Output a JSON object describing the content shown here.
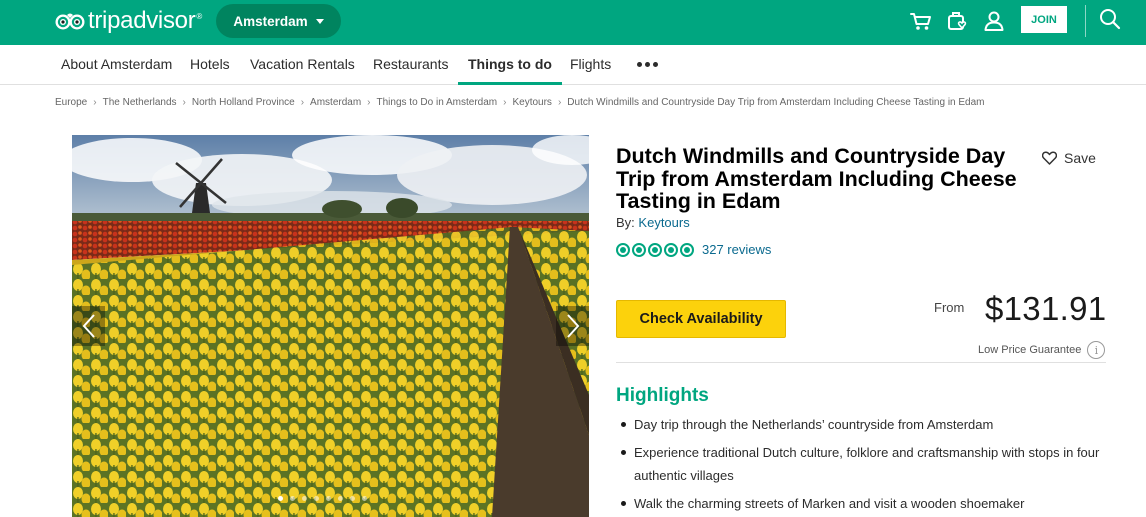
{
  "header": {
    "logo_text": "tripadvisor",
    "logo_reg": "®",
    "city": "Amsterdam",
    "join_label": "JOIN",
    "icons": [
      "cart-icon",
      "luggage-heart-icon",
      "user-icon",
      "search-icon"
    ],
    "brand_color": "#00a680"
  },
  "nav": {
    "items": [
      {
        "label": "About Amsterdam"
      },
      {
        "label": "Hotels"
      },
      {
        "label": "Vacation Rentals"
      },
      {
        "label": "Restaurants"
      },
      {
        "label": "Things to do",
        "active": true
      },
      {
        "label": "Flights"
      }
    ],
    "more_icon": "more-dots-icon"
  },
  "breadcrumbs": [
    "Europe",
    "The Netherlands",
    "North Holland Province",
    "Amsterdam",
    "Things to Do in Amsterdam",
    "Keytours",
    "Dutch Windmills and Countryside Day Trip from Amsterdam Including Cheese Tasting in Edam"
  ],
  "gallery": {
    "dot_count": 8,
    "active_dot": 0
  },
  "product": {
    "title": "Dutch Windmills and Countryside Day Trip from Amsterdam Including Cheese Tasting in Edam",
    "save_label": "Save",
    "by_prefix": "By:",
    "operator": "Keytours",
    "rating": 5,
    "reviews_label": "327 reviews",
    "check_label": "Check Availability",
    "from_label": "From",
    "price": "$131.91",
    "low_price_label": "Low Price Guarantee",
    "info_glyph": "i"
  },
  "highlights": {
    "title": "Highlights",
    "items": [
      "Day trip through the Netherlands’ countryside from Amsterdam",
      "Experience traditional Dutch culture, folklore and craftsmanship with stops in four authentic villages",
      "Walk the charming streets of Marken and visit a wooden shoemaker"
    ]
  }
}
